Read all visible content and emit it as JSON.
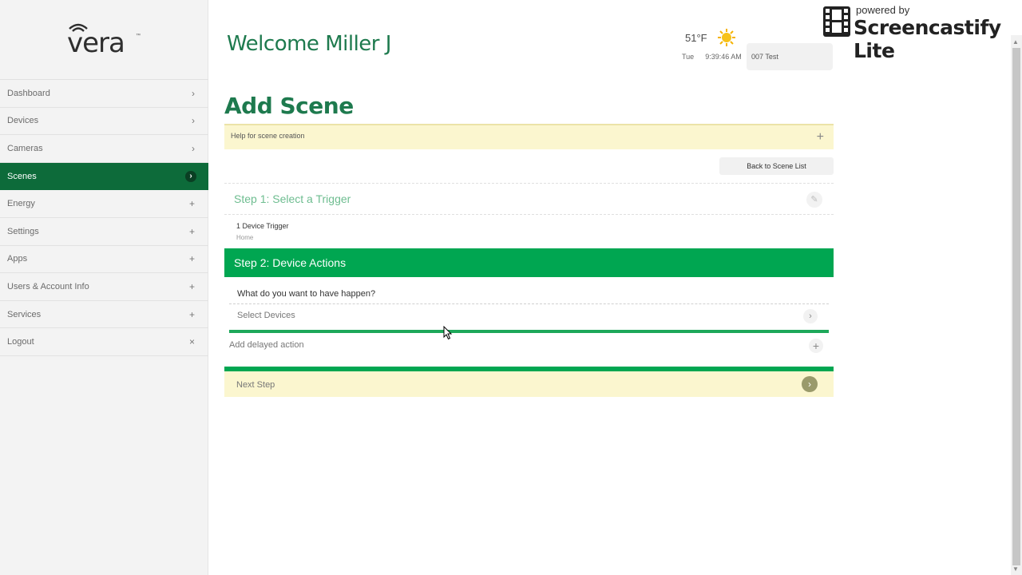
{
  "brand": {
    "logo_text": "vera",
    "trademark": "™"
  },
  "sidebar": {
    "items": [
      {
        "label": "Dashboard",
        "indicator": "›"
      },
      {
        "label": "Devices",
        "indicator": "›"
      },
      {
        "label": "Cameras",
        "indicator": "›"
      },
      {
        "label": "Scenes",
        "indicator": "›",
        "active": true
      },
      {
        "label": "Energy",
        "indicator": "+"
      },
      {
        "label": "Settings",
        "indicator": "+"
      },
      {
        "label": "Apps",
        "indicator": "+"
      },
      {
        "label": "Users & Account Info",
        "indicator": "+"
      },
      {
        "label": "Services",
        "indicator": "+"
      },
      {
        "label": "Logout",
        "indicator": "×"
      }
    ]
  },
  "header": {
    "welcome": "Welcome Miller J",
    "temperature": "51°F",
    "weather_icon": "sun-icon",
    "day": "Tue",
    "time": "9:39:46 AM",
    "controller": "007 Test"
  },
  "watermark": {
    "powered": "powered by",
    "brand": "Screencastify Lite"
  },
  "main": {
    "title": "Add Scene",
    "help": {
      "label": "Help for scene creation",
      "toggle": "+"
    },
    "back_button": "Back to Scene List",
    "step1": {
      "label": "Step 1: Select a Trigger",
      "edit_icon": "✎",
      "trigger_name": "1 Device Trigger",
      "trigger_sub": "Home"
    },
    "step2": {
      "label": "Step 2: Device Actions",
      "question": "What do you want to have happen?",
      "select_devices": "Select Devices",
      "select_chevron": "›",
      "delayed_action": "Add delayed action",
      "delayed_plus": "+"
    },
    "next": {
      "label": "Next Step",
      "button": "›"
    }
  },
  "colors": {
    "primary_dark": "#0d6b3a",
    "primary": "#00a651",
    "heading": "#1e7a4e",
    "highlight_bg": "#fbf6cf"
  }
}
